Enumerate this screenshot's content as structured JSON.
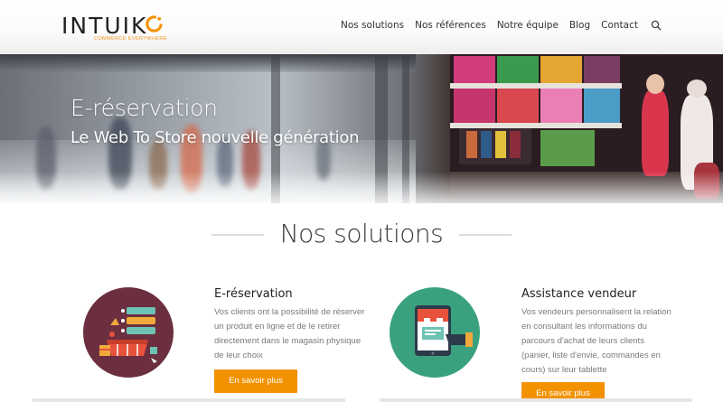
{
  "brand": {
    "name_part": "INTUIK",
    "tagline": "COMMERCE EVERYWHERE",
    "accent_color": "#f39200"
  },
  "nav": {
    "items": [
      {
        "label": "Nos solutions"
      },
      {
        "label": "Nos références"
      },
      {
        "label": "Notre équipe"
      },
      {
        "label": "Blog"
      },
      {
        "label": "Contact"
      }
    ],
    "search_icon": "search-icon"
  },
  "hero": {
    "title": "E-réservation",
    "subtitle": "Le Web To Store nouvelle génération"
  },
  "section": {
    "title": "Nos solutions"
  },
  "cards": [
    {
      "title": "E-réservation",
      "description": "Vos clients ont la possibilité de réserver un produit en ligne et de le retirer directement dans le magasin physique de leur choix",
      "button_label": "En savoir plus",
      "icon": "shopping-basket-icon",
      "icon_bg": "#6b2f3f"
    },
    {
      "title": "Assistance vendeur",
      "description": "Vos vendeurs personnalisent la relation en consultant les informations du parcours d'achat de leurs clients (panier, liste d'envie, commandes en cours) sur leur tablette",
      "button_label": "En savoir plus",
      "icon": "tablet-store-icon",
      "icon_bg": "#3aa17e"
    }
  ]
}
